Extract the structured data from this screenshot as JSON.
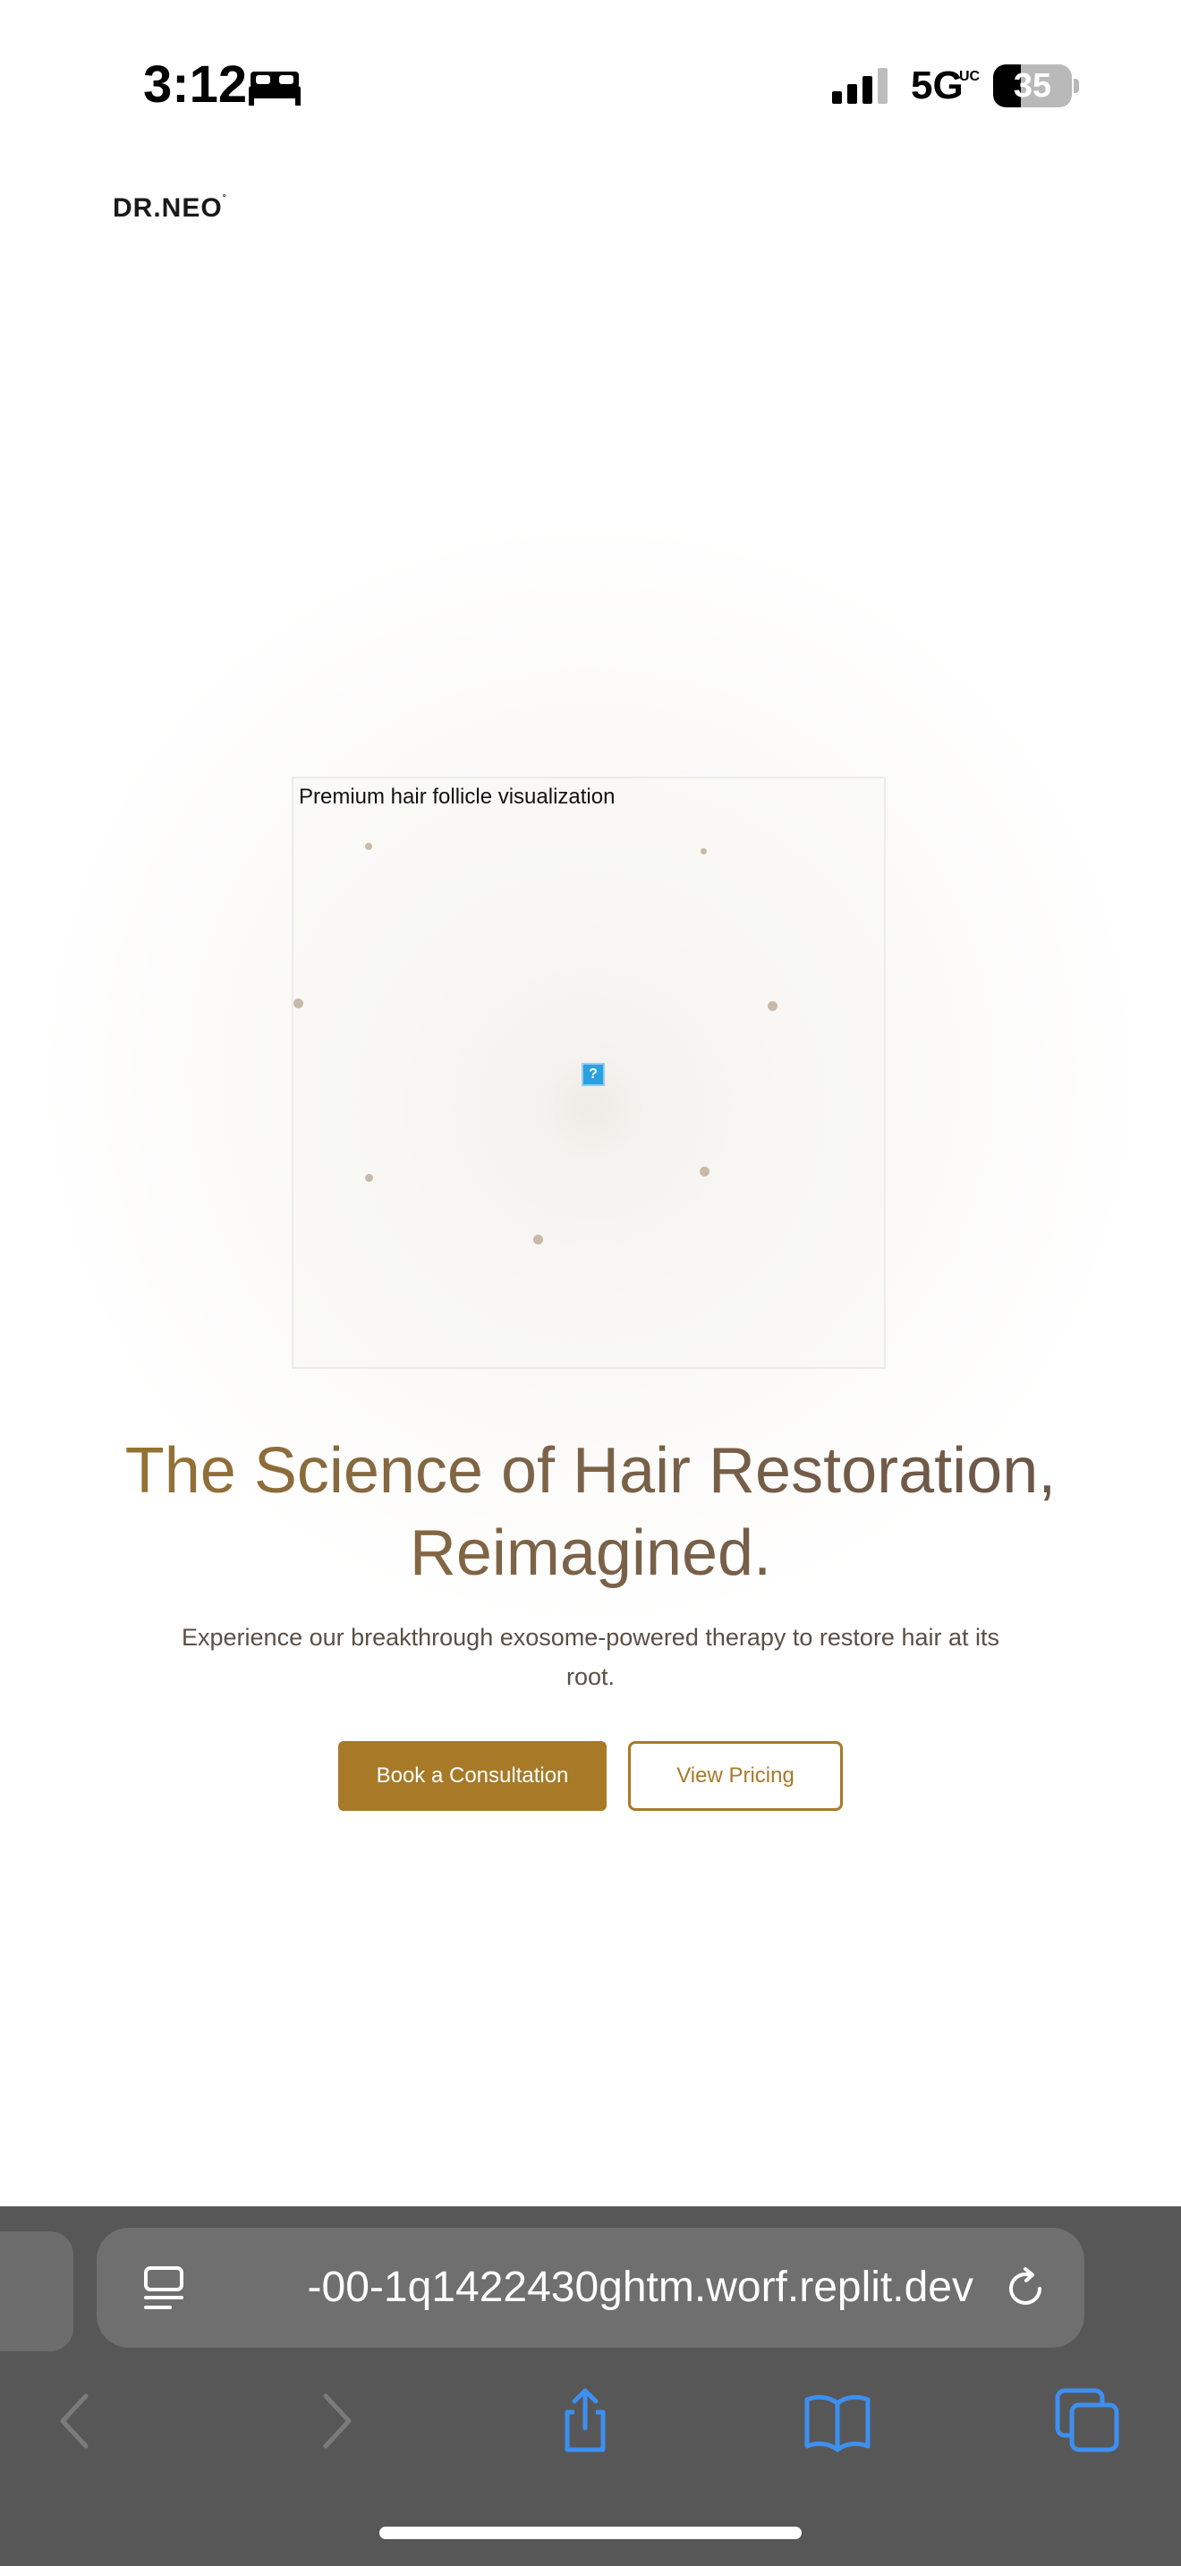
{
  "status_bar": {
    "time": "3:12",
    "network": "5G",
    "network_sub": "UC",
    "battery_level": 35,
    "battery_text": "35"
  },
  "brand": {
    "logo_text": "DR.NEO"
  },
  "hero": {
    "image_alt": "Premium hair follicle visualization",
    "title": "The Science of Hair Restoration, Reimagined.",
    "subtitle": "Experience our breakthrough exosome-powered therapy to restore hair at its root.",
    "primary_cta": "Book a Consultation",
    "secondary_cta": "View Pricing",
    "broken_image_glyph": "?"
  },
  "browser": {
    "url": "-00-1q1422430ghtm.worf.replit.dev"
  },
  "colors": {
    "accent": "#a87a28",
    "browser_chrome": "#575757",
    "toolbar_icon_blue": "#3d8ff0",
    "toolbar_icon_disabled": "#7b7b7b"
  },
  "icons": {
    "status": [
      "bed-icon",
      "signal-icon",
      "battery-icon"
    ],
    "toolbar": [
      "back-icon",
      "forward-icon",
      "share-icon",
      "bookmarks-icon",
      "tabs-icon"
    ],
    "url_bar": [
      "reader-mode-icon",
      "reload-icon"
    ]
  }
}
